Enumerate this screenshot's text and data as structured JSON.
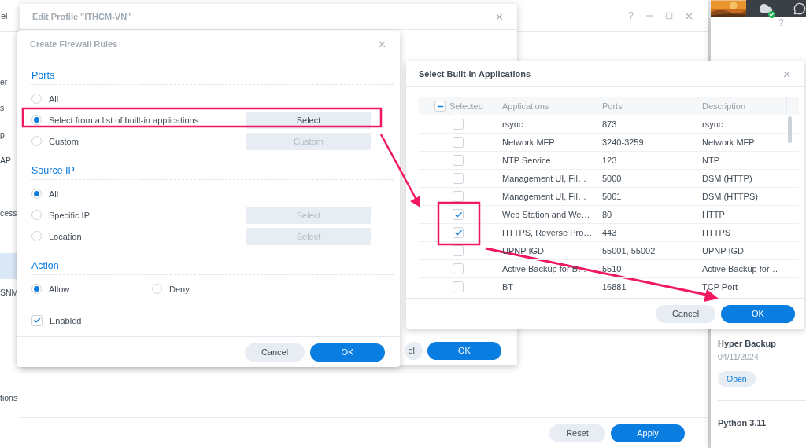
{
  "control_panel": {
    "title_fragment": "el",
    "help": "?",
    "sidebar": [
      {
        "label": "er",
        "selected": false
      },
      {
        "label": "s",
        "selected": false
      },
      {
        "label": "p",
        "selected": false
      },
      {
        "label": "AP",
        "selected": false
      },
      {
        "label": "cess",
        "selected": false
      },
      {
        "selected": true
      },
      {
        "label": "SNM",
        "selected": false
      },
      {
        "label": "tions",
        "selected": false
      }
    ],
    "buttons": [
      {
        "label": "Reset",
        "kind": "secondary"
      },
      {
        "label": "Apply",
        "kind": "primary"
      }
    ]
  },
  "edit_profile": {
    "title": "Edit Profile \"ITHCM-VN\"",
    "buttons": [
      {
        "label": "el",
        "kind": "secondary"
      },
      {
        "label": "OK",
        "kind": "primary"
      }
    ]
  },
  "package_center": {
    "help": "?",
    "apps": [
      {
        "name": "Hyper Backup",
        "date": "04/11/2024",
        "action": "Open"
      },
      {
        "name": "Python 3.11"
      }
    ]
  },
  "firewall": {
    "title": "Create Firewall Rules",
    "sections": [
      {
        "heading": "Ports",
        "kind": "stack",
        "options": [
          {
            "label": "All",
            "selected": false
          },
          {
            "label": "Select from a list of built-in applications",
            "selected": true,
            "button": {
              "label": "Select",
              "disabled": false
            }
          },
          {
            "label": "Custom",
            "selected": false,
            "button": {
              "label": "Custom",
              "disabled": true
            }
          }
        ]
      },
      {
        "heading": "Source IP",
        "kind": "stack",
        "options": [
          {
            "label": "All",
            "selected": true
          },
          {
            "label": "Specific IP",
            "selected": false,
            "button": {
              "label": "Select",
              "disabled": true
            }
          },
          {
            "label": "Location",
            "selected": false,
            "button": {
              "label": "Select",
              "disabled": true
            }
          }
        ]
      },
      {
        "heading": "Action",
        "kind": "inline",
        "options": [
          {
            "label": "Allow",
            "selected": true
          },
          {
            "label": "Deny",
            "selected": false
          }
        ]
      }
    ],
    "enabled": {
      "label": "Enabled",
      "checked": true
    },
    "buttons": [
      {
        "label": "Cancel",
        "kind": "secondary"
      },
      {
        "label": "OK",
        "kind": "primary"
      }
    ]
  },
  "select_apps": {
    "title": "Select Built-in Applications",
    "header_partial": true,
    "columns": [
      "Selected",
      "Applications",
      "Ports",
      "Description"
    ],
    "rows": [
      {
        "checked": false,
        "application": "rsync",
        "ports": "873",
        "description": "rsync"
      },
      {
        "checked": false,
        "application": "Network MFP",
        "ports": "3240-3259",
        "description": "Network MFP"
      },
      {
        "checked": false,
        "application": "NTP Service",
        "ports": "123",
        "description": "NTP"
      },
      {
        "checked": false,
        "application": "Management UI, Fil…",
        "ports": "5000",
        "description": "DSM (HTTP)"
      },
      {
        "checked": false,
        "application": "Management UI, Fil…",
        "ports": "5001",
        "description": "DSM (HTTPS)"
      },
      {
        "checked": true,
        "application": "Web Station and We…",
        "ports": "80",
        "description": "HTTP"
      },
      {
        "checked": true,
        "application": "HTTPS, Reverse Pro…",
        "ports": "443",
        "description": "HTTPS"
      },
      {
        "checked": false,
        "application": "UPNP IGD",
        "ports": "55001, 55002",
        "description": "UPNP IGD"
      },
      {
        "checked": false,
        "application": "Active Backup for B…",
        "ports": "5510",
        "description": "Active Backup for…"
      },
      {
        "checked": false,
        "application": "BT",
        "ports": "16881",
        "description": "TCP Port"
      }
    ],
    "buttons": [
      {
        "label": "Cancel",
        "kind": "secondary"
      },
      {
        "label": "OK",
        "kind": "primary"
      }
    ]
  }
}
